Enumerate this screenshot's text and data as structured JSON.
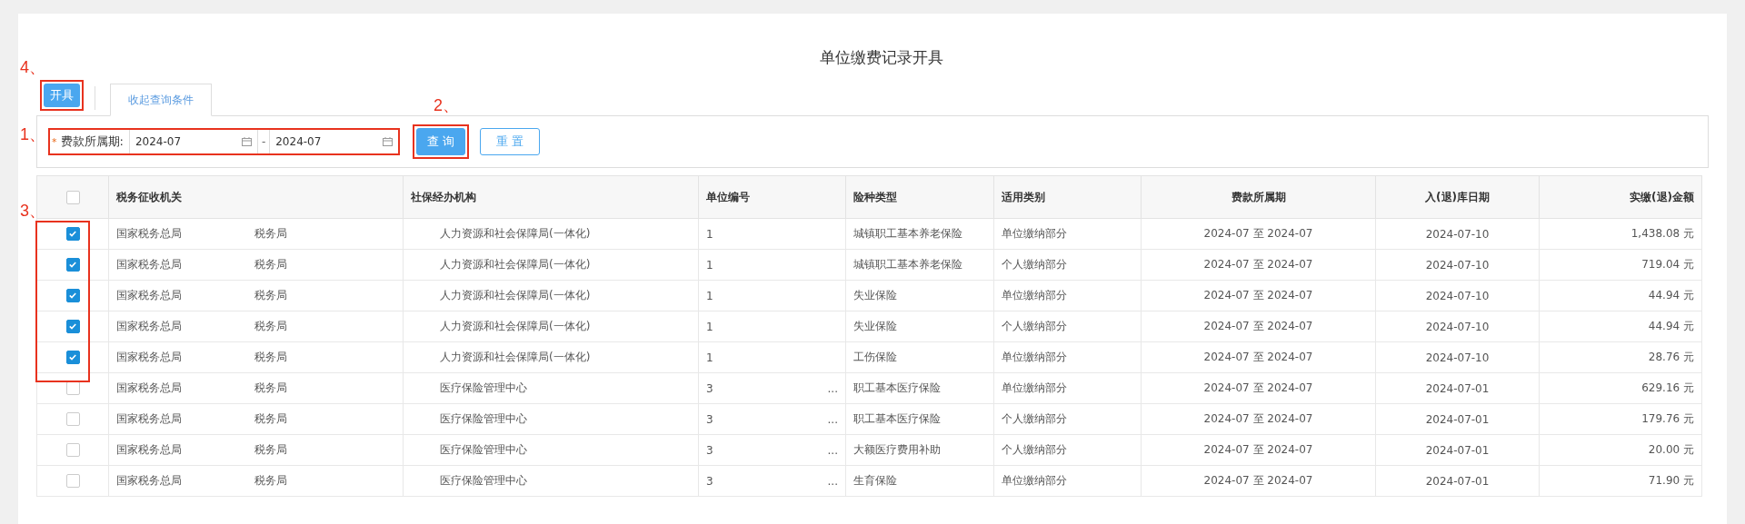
{
  "page_title": "单位缴费记录开具",
  "toolbar": {
    "issue_button": "开具",
    "tab": {
      "label": "收起查询条件",
      "selected": true
    }
  },
  "filter": {
    "label": "费款所属期:",
    "required_mark": "*",
    "start": "2024-07",
    "separator": "-",
    "end": "2024-07",
    "buttons": [
      {
        "label": "查 询",
        "kind": "primary"
      },
      {
        "label": "重 置",
        "kind": "secondary"
      }
    ]
  },
  "annotations": {
    "issue": "4、",
    "filter": "1、",
    "query": "2、",
    "checks": "3、"
  },
  "table": {
    "header_checked": false,
    "columns": [
      "税务征收机关",
      "社保经办机构",
      "单位编号",
      "险种类型",
      "适用类别",
      "费款所属期",
      "入(退)库日期",
      "实缴(退)金额"
    ],
    "rows": [
      {
        "checked": true,
        "tax_office": [
          "国家税务总局",
          "税务局"
        ],
        "agency": "人力资源和社会保障局(一体化)",
        "unit_no": "1",
        "unit_more": "",
        "insurance": "城镇职工基本养老保险",
        "category": "单位缴纳部分",
        "period": "2024-07 至 2024-07",
        "date": "2024-07-10",
        "amount": "1,438.08 元"
      },
      {
        "checked": true,
        "tax_office": [
          "国家税务总局",
          "税务局"
        ],
        "agency": "人力资源和社会保障局(一体化)",
        "unit_no": "1",
        "unit_more": "",
        "insurance": "城镇职工基本养老保险",
        "category": "个人缴纳部分",
        "period": "2024-07 至 2024-07",
        "date": "2024-07-10",
        "amount": "719.04 元"
      },
      {
        "checked": true,
        "tax_office": [
          "国家税务总局",
          "税务局"
        ],
        "agency": "人力资源和社会保障局(一体化)",
        "unit_no": "1",
        "unit_more": "",
        "insurance": "失业保险",
        "category": "单位缴纳部分",
        "period": "2024-07 至 2024-07",
        "date": "2024-07-10",
        "amount": "44.94 元"
      },
      {
        "checked": true,
        "tax_office": [
          "国家税务总局",
          "税务局"
        ],
        "agency": "人力资源和社会保障局(一体化)",
        "unit_no": "1",
        "unit_more": "",
        "insurance": "失业保险",
        "category": "个人缴纳部分",
        "period": "2024-07 至 2024-07",
        "date": "2024-07-10",
        "amount": "44.94 元"
      },
      {
        "checked": true,
        "tax_office": [
          "国家税务总局",
          "税务局"
        ],
        "agency": "人力资源和社会保障局(一体化)",
        "unit_no": "1",
        "unit_more": "",
        "insurance": "工伤保险",
        "category": "单位缴纳部分",
        "period": "2024-07 至 2024-07",
        "date": "2024-07-10",
        "amount": "28.76 元"
      },
      {
        "checked": false,
        "tax_office": [
          "国家税务总局",
          "税务局"
        ],
        "agency": "医疗保险管理中心",
        "unit_no": "3",
        "unit_more": "...",
        "insurance": "职工基本医疗保险",
        "category": "单位缴纳部分",
        "period": "2024-07 至 2024-07",
        "date": "2024-07-01",
        "amount": "629.16 元"
      },
      {
        "checked": false,
        "tax_office": [
          "国家税务总局",
          "税务局"
        ],
        "agency": "医疗保险管理中心",
        "unit_no": "3",
        "unit_more": "...",
        "insurance": "职工基本医疗保险",
        "category": "个人缴纳部分",
        "period": "2024-07 至 2024-07",
        "date": "2024-07-01",
        "amount": "179.76 元"
      },
      {
        "checked": false,
        "tax_office": [
          "国家税务总局",
          "税务局"
        ],
        "agency": "医疗保险管理中心",
        "unit_no": "3",
        "unit_more": "...",
        "insurance": "大额医疗费用补助",
        "category": "个人缴纳部分",
        "period": "2024-07 至 2024-07",
        "date": "2024-07-01",
        "amount": "20.00 元"
      },
      {
        "checked": false,
        "tax_office": [
          "国家税务总局",
          "税务局"
        ],
        "agency": "医疗保险管理中心",
        "unit_no": "3",
        "unit_more": "...",
        "insurance": "生育保险",
        "category": "单位缴纳部分",
        "period": "2024-07 至 2024-07",
        "date": "2024-07-01",
        "amount": "71.90 元"
      }
    ]
  }
}
